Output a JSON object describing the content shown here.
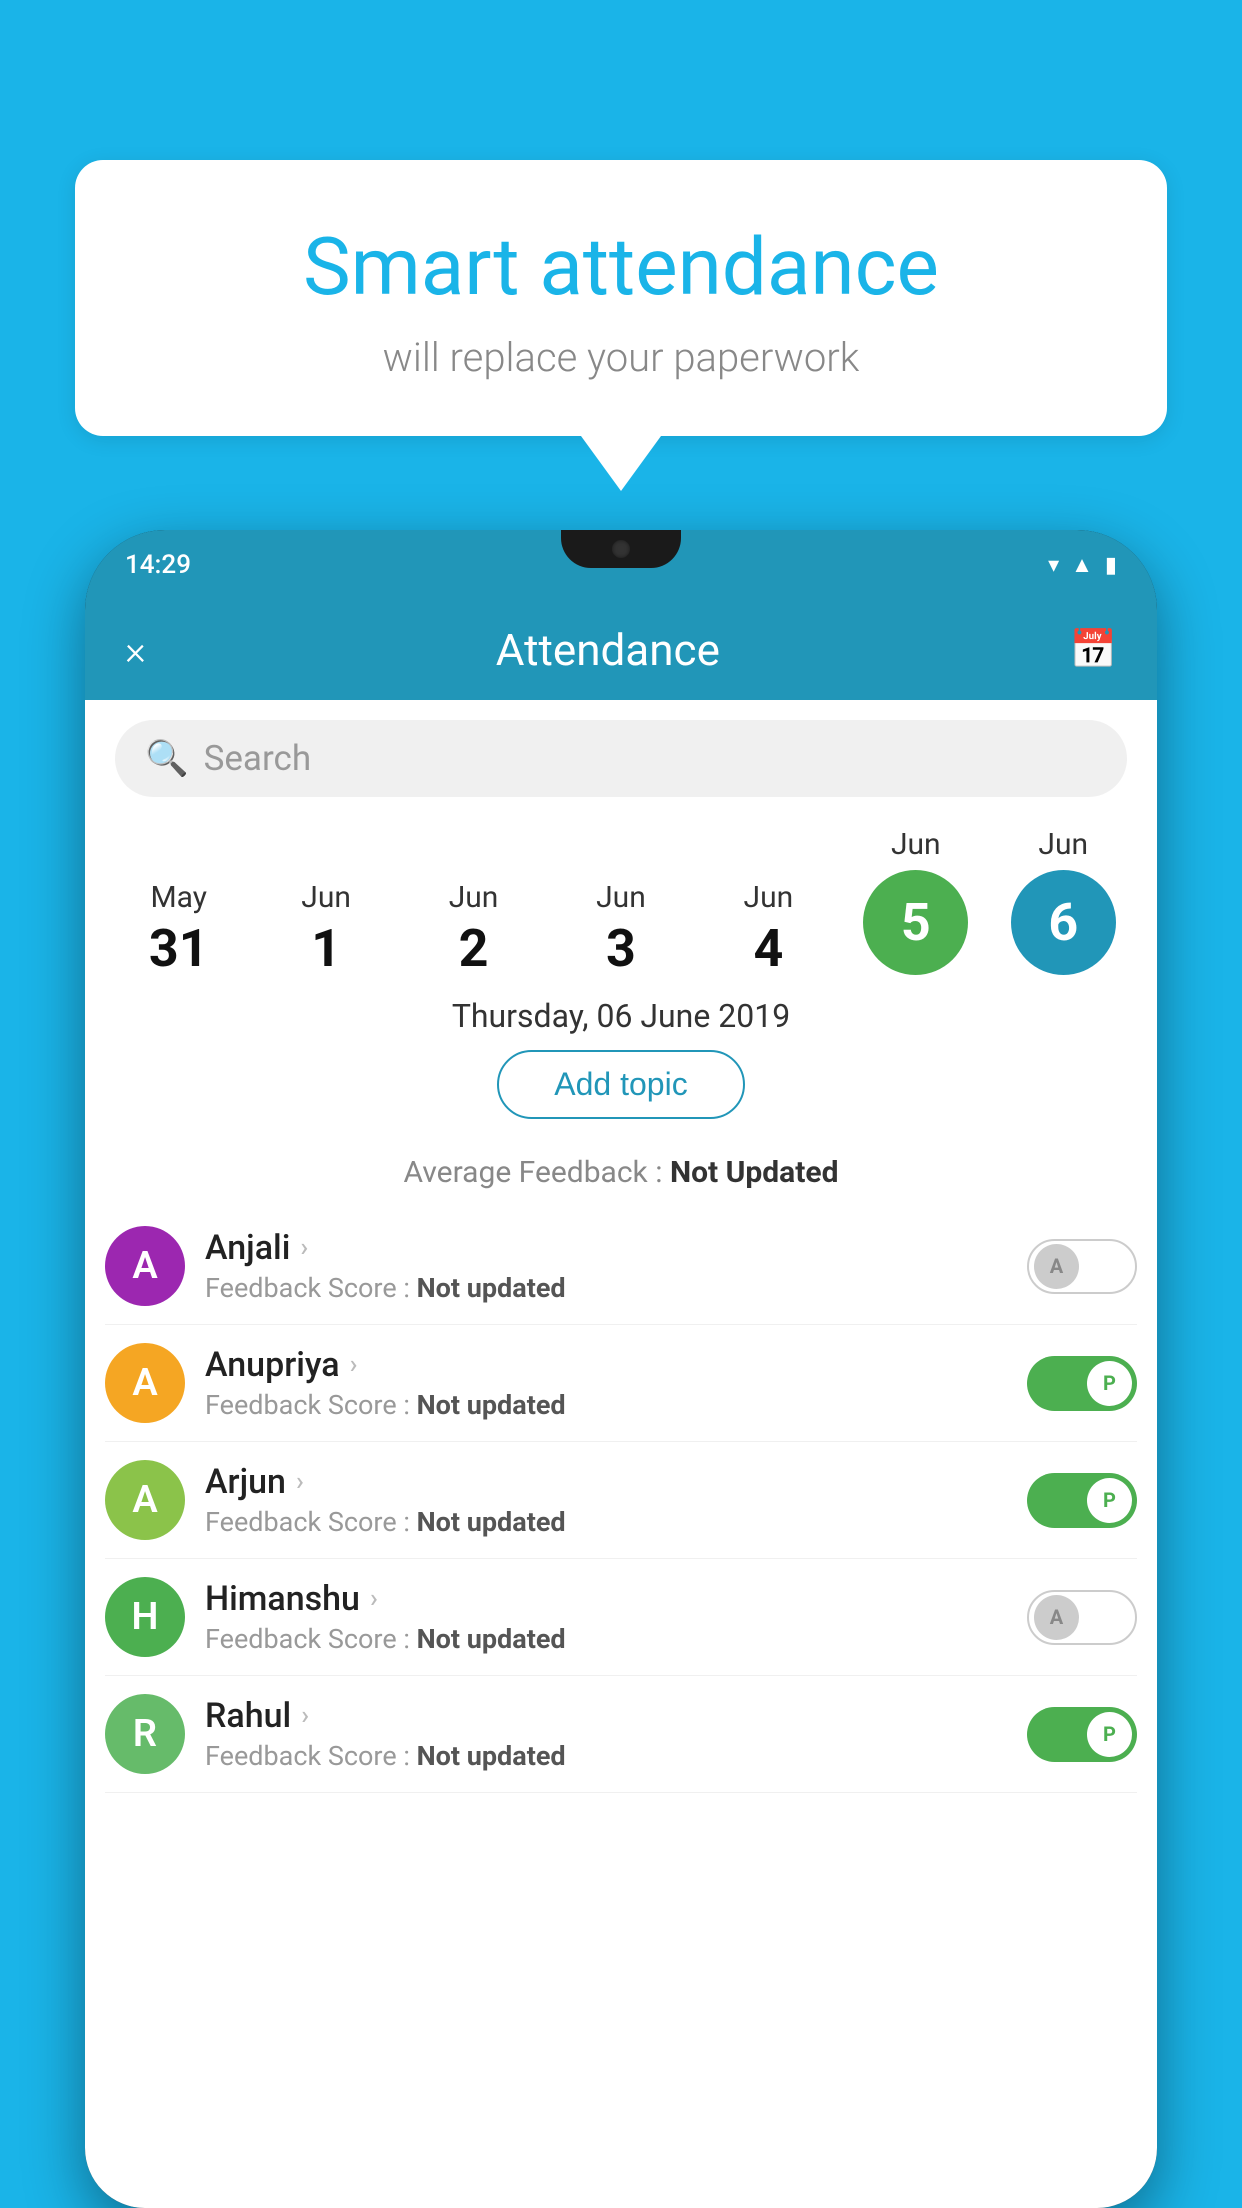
{
  "background_color": "#1ab4e8",
  "speech_bubble": {
    "title": "Smart attendance",
    "subtitle": "will replace your paperwork"
  },
  "phone": {
    "time": "14:29",
    "app_header": {
      "title": "Attendance",
      "close_label": "×",
      "calendar_icon": "📅"
    },
    "search": {
      "placeholder": "Search"
    },
    "dates": [
      {
        "month": "May",
        "day": "31",
        "type": "normal"
      },
      {
        "month": "Jun",
        "day": "1",
        "type": "normal"
      },
      {
        "month": "Jun",
        "day": "2",
        "type": "normal"
      },
      {
        "month": "Jun",
        "day": "3",
        "type": "normal"
      },
      {
        "month": "Jun",
        "day": "4",
        "type": "normal"
      },
      {
        "month": "Jun",
        "day": "5",
        "type": "green"
      },
      {
        "month": "Jun",
        "day": "6",
        "type": "blue"
      }
    ],
    "selected_date": "Thursday, 06 June 2019",
    "add_topic_label": "Add topic",
    "average_feedback_label": "Average Feedback :",
    "average_feedback_value": "Not Updated",
    "students": [
      {
        "name": "Anjali",
        "avatar_letter": "A",
        "avatar_color": "purple",
        "feedback_label": "Feedback Score :",
        "feedback_value": "Not updated",
        "toggle": "off",
        "toggle_letter": "A"
      },
      {
        "name": "Anupriya",
        "avatar_letter": "A",
        "avatar_color": "orange",
        "feedback_label": "Feedback Score :",
        "feedback_value": "Not updated",
        "toggle": "on",
        "toggle_letter": "P"
      },
      {
        "name": "Arjun",
        "avatar_letter": "A",
        "avatar_color": "green-light",
        "feedback_label": "Feedback Score :",
        "feedback_value": "Not updated",
        "toggle": "on",
        "toggle_letter": "P"
      },
      {
        "name": "Himanshu",
        "avatar_letter": "H",
        "avatar_color": "teal",
        "feedback_label": "Feedback Score :",
        "feedback_value": "Not updated",
        "toggle": "off",
        "toggle_letter": "A"
      },
      {
        "name": "Rahul",
        "avatar_letter": "R",
        "avatar_color": "green2",
        "feedback_label": "Feedback Score :",
        "feedback_value": "Not updated",
        "toggle": "on",
        "toggle_letter": "P"
      }
    ]
  }
}
